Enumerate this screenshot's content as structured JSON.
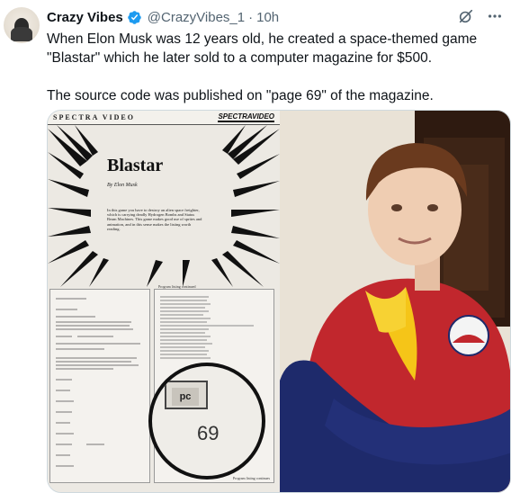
{
  "author": {
    "name": "Crazy Vibes",
    "handle": "@CrazyVibes_1",
    "separator": "·",
    "time": "10h",
    "verified_color": "#1d9bf0"
  },
  "tweet": {
    "line1": "When Elon Musk was 12 years old, he created a space-themed game",
    "line2": "\"Blastar\" which he later sold to a computer magazine for $500.",
    "line3": "The source code was published on \"page 69\" of the magazine."
  },
  "actions": {
    "grok_icon": "grok-icon",
    "more_icon": "more-icon"
  },
  "media": {
    "magazine": {
      "header_left": "SPECTRA VIDEO",
      "header_right": "SPECTRAVIDEO",
      "title": "Blastar",
      "byline": "By Elon Musk",
      "body": "In this game you have to destroy an alien space freighter, which is carrying deadly Hydrogen Bombs and Status Beam Machines. This game makes good use of sprites and animation, and in this sense makes the listing worth reading.",
      "listing_caption": "Program listing continued",
      "listing_footer": "Program listing continues",
      "zoom_label": "pc",
      "page_number": "69"
    }
  }
}
